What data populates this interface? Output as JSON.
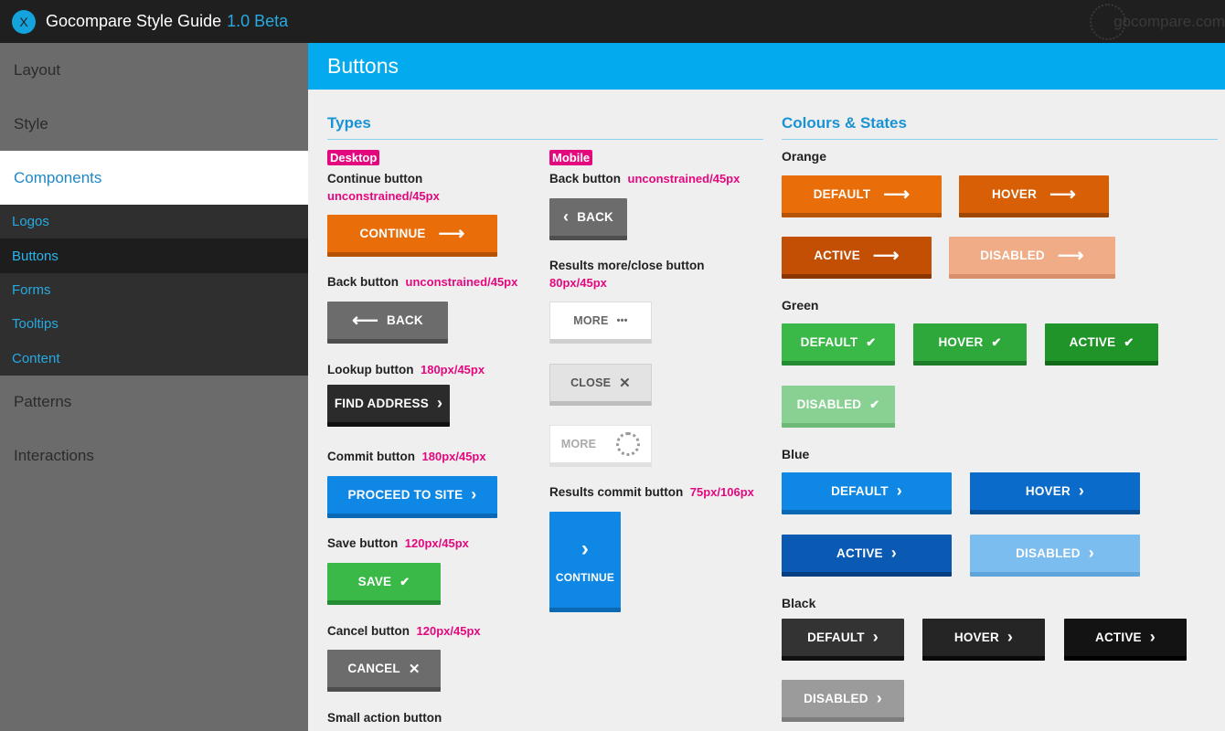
{
  "header": {
    "close_icon": "X",
    "title": "Gocompare Style Guide",
    "version": "1.0 Beta",
    "brand": "gocompare.com"
  },
  "sidebar": {
    "layout": "Layout",
    "style": "Style",
    "components": "Components",
    "sub": [
      "Logos",
      "Buttons",
      "Forms",
      "Tooltips",
      "Content"
    ],
    "patterns": "Patterns",
    "interactions": "Interactions"
  },
  "page": {
    "title": "Buttons"
  },
  "types": {
    "title": "Types",
    "desktop_tag": "Desktop",
    "mobile_tag": "Mobile",
    "continue": {
      "label": "Continue button",
      "spec": "unconstrained/45px",
      "btn": "CONTINUE"
    },
    "back": {
      "label": "Back button",
      "spec": "unconstrained/45px",
      "btn": "BACK"
    },
    "lookup": {
      "label": "Lookup button",
      "spec": "180px/45px",
      "btn": "FIND ADDRESS"
    },
    "commit": {
      "label": "Commit button",
      "spec": "180px/45px",
      "btn": "PROCEED TO SITE"
    },
    "save": {
      "label": "Save button",
      "spec": "120px/45px",
      "btn": "SAVE"
    },
    "cancel": {
      "label": "Cancel button",
      "spec": "120px/45px",
      "btn": "CANCEL"
    },
    "small": {
      "label": "Small action button"
    },
    "m_back": {
      "label": "Back button",
      "spec": "unconstrained/45px",
      "btn": "BACK"
    },
    "m_results": {
      "label": "Results more/close button",
      "spec": "80px/45px",
      "more": "MORE",
      "close": "CLOSE",
      "more_loading": "MORE"
    },
    "m_commit": {
      "label": "Results commit button",
      "spec": "75px/106px",
      "btn": "CONTINUE"
    }
  },
  "states": {
    "title": "Colours & States",
    "orange": {
      "label": "Orange",
      "default": "DEFAULT",
      "hover": "HOVER",
      "active": "ACTIVE",
      "disabled": "DISABLED"
    },
    "green": {
      "label": "Green",
      "default": "DEFAULT",
      "hover": "HOVER",
      "active": "ACTIVE",
      "disabled": "DISABLED"
    },
    "blue": {
      "label": "Blue",
      "default": "DEFAULT",
      "hover": "HOVER",
      "active": "ACTIVE",
      "disabled": "DISABLED"
    },
    "black": {
      "label": "Black",
      "default": "DEFAULT",
      "hover": "HOVER",
      "active": "ACTIVE",
      "disabled": "DISABLED"
    }
  },
  "icons": {
    "arrow_right": "⟶",
    "arrow_left": "⟵",
    "chevron_right": "›",
    "chevron_left": "‹",
    "check": "✔",
    "cross": "✕",
    "dots": "•••"
  },
  "colors": {
    "accent": "#04aaee",
    "orange": "#e96d08",
    "green": "#3ab948",
    "blue": "#0f87e4",
    "pink": "#e4087f"
  }
}
